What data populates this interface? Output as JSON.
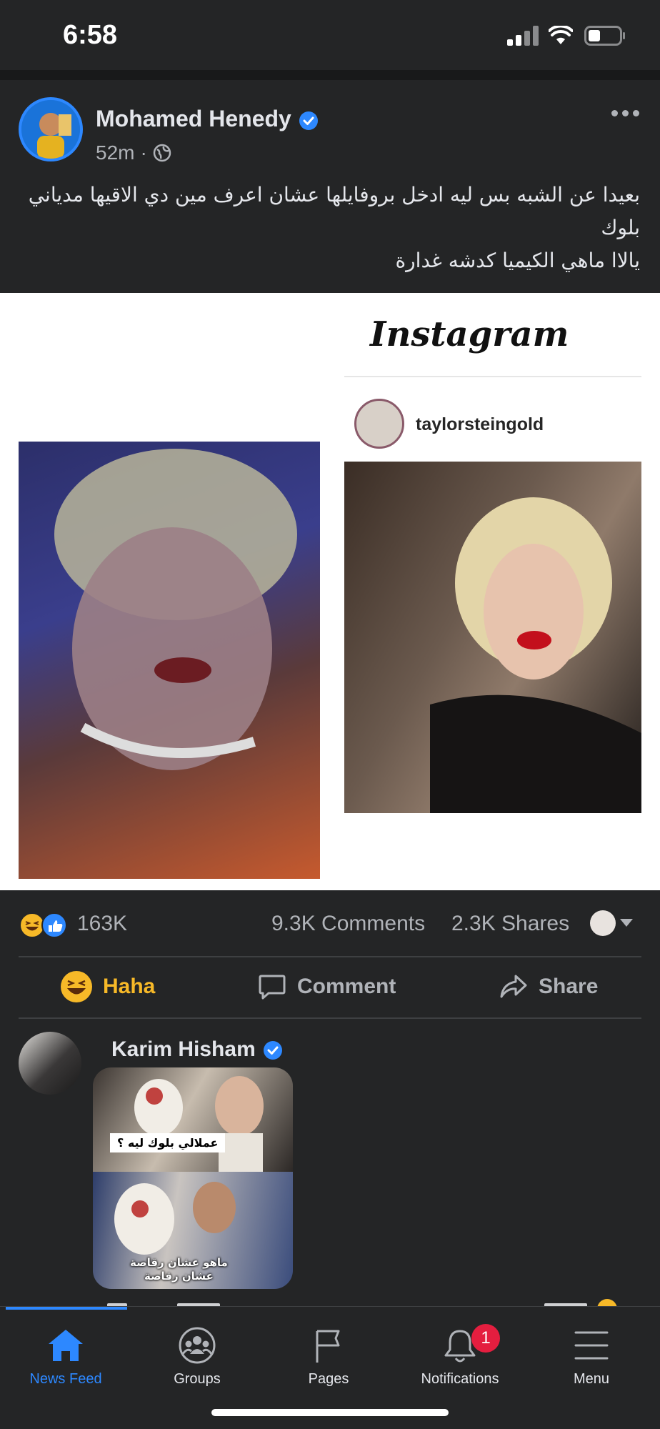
{
  "status_bar": {
    "time": "6:58"
  },
  "post": {
    "author": "Mohamed Henedy",
    "time": "52m",
    "separator": "·",
    "text": "بعيدا عن الشبه بس ليه ادخل بروفايلها  عشان اعرف مين دي الاقيها مدياني بلوك\nيالاا ماهي الكيميا كدشه غدارة",
    "image": {
      "brand": "Instagram",
      "username": "taylorsteingold"
    },
    "stats": {
      "reactions": "163K",
      "comments": "9.3K Comments",
      "shares": "2.3K Shares"
    },
    "actions": {
      "haha": "Haha",
      "comment": "Comment",
      "share": "Share"
    }
  },
  "comment": {
    "author": "Karim Hisham",
    "sticker_caption_top": "عملالي بلوك ليه ؟",
    "sticker_caption_bottom": "ماهو عشان رقاصة\nعشان رقاصة"
  },
  "tabbar": {
    "items": [
      {
        "label": "News Feed",
        "icon": "home-icon",
        "active": true
      },
      {
        "label": "Groups",
        "icon": "groups-icon"
      },
      {
        "label": "Pages",
        "icon": "flag-icon"
      },
      {
        "label": "Notifications",
        "icon": "bell-icon",
        "badge": "1"
      },
      {
        "label": "Menu",
        "icon": "hamburger-icon"
      }
    ]
  },
  "colors": {
    "background": "#242526",
    "accent": "#2d88ff",
    "haha": "#f7b928",
    "badge": "#e41e3f"
  }
}
